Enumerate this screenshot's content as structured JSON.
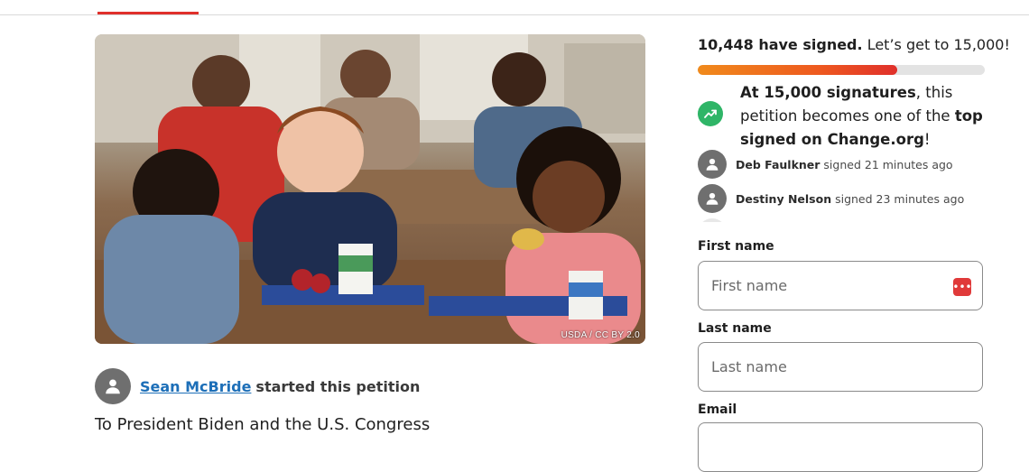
{
  "nav": {
    "active_tab_color": "#e0302b"
  },
  "hero": {
    "image_alt": "Children eating lunch in a school cafeteria",
    "credit": "USDA / CC BY 2.0"
  },
  "author": {
    "name": "Sean McBride",
    "started_text": "started this petition"
  },
  "petition": {
    "opening": "To President Biden and the U.S. Congress"
  },
  "signatures": {
    "count_bold": "10,448 have signed.",
    "goal_text": "Let’s get to 15,000!",
    "progress_fraction": 0.6965,
    "milestone": {
      "bold1": "At 15,000 signatures",
      "text1": ", this petition becomes one of the ",
      "bold2": "top signed on Change.org",
      "text2": "!"
    },
    "recent": [
      {
        "name": "Deb Faulkner",
        "action": "signed 21 minutes ago"
      },
      {
        "name": "Destiny Nelson",
        "action": "signed 23 minutes ago"
      }
    ]
  },
  "form": {
    "first_name": {
      "label": "First name",
      "placeholder": "First name",
      "value": ""
    },
    "last_name": {
      "label": "Last name",
      "placeholder": "Last name",
      "value": ""
    },
    "email": {
      "label": "Email"
    }
  },
  "colors": {
    "accent": "#e0302b",
    "link": "#1d6fb8",
    "trend_green": "#2fb567"
  }
}
